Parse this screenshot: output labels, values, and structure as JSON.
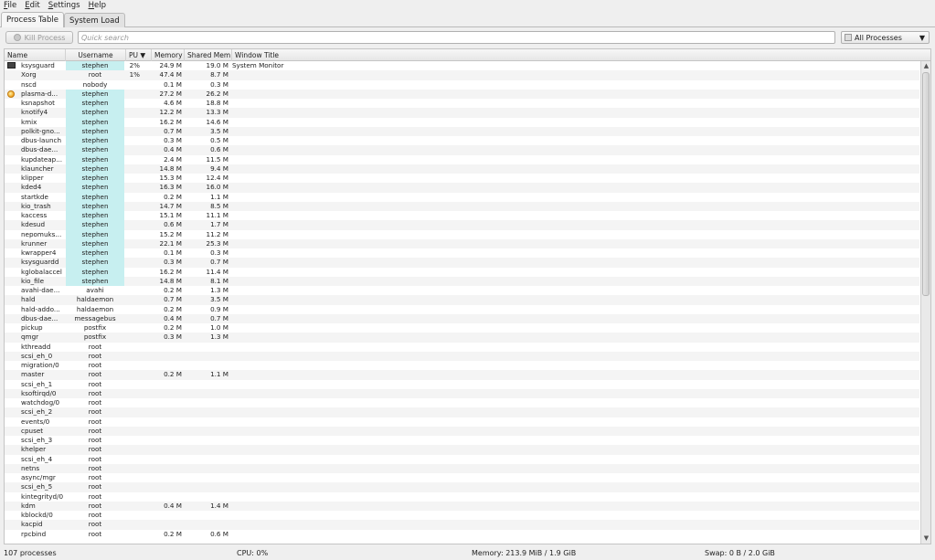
{
  "menu": [
    "File",
    "Edit",
    "Settings",
    "Help"
  ],
  "tabs": [
    "Process Table",
    "System Load"
  ],
  "toolbar": {
    "kill_label": "Kill Process",
    "search_placeholder": "Quick search",
    "filter_value": "All Processes"
  },
  "columns": {
    "name": "Name",
    "username": "Username",
    "cpu": "PU",
    "memory": "Memory",
    "shared": "Shared Mem",
    "window_title": "Window Title"
  },
  "rows": [
    {
      "icon": "monitor",
      "name": "ksysguard",
      "user": "stephen",
      "cpu": "2%",
      "mem": "24.9 M",
      "shared": "19.0 M",
      "title": "System Monitor",
      "hl": true
    },
    {
      "icon": "",
      "name": "Xorg",
      "user": "root",
      "cpu": "1%",
      "mem": "47.4 M",
      "shared": "8.7 M",
      "title": "",
      "hl": false
    },
    {
      "icon": "",
      "name": "nscd",
      "user": "nobody",
      "cpu": "",
      "mem": "0.1 M",
      "shared": "0.3 M",
      "title": "",
      "hl": false
    },
    {
      "icon": "plasma",
      "name": "plasma-d...",
      "user": "stephen",
      "cpu": "",
      "mem": "27.2 M",
      "shared": "26.2 M",
      "title": "",
      "hl": true
    },
    {
      "icon": "",
      "name": "ksnapshot",
      "user": "stephen",
      "cpu": "",
      "mem": "4.6 M",
      "shared": "18.8 M",
      "title": "",
      "hl": true
    },
    {
      "icon": "",
      "name": "knotify4",
      "user": "stephen",
      "cpu": "",
      "mem": "12.2 M",
      "shared": "13.3 M",
      "title": "",
      "hl": true
    },
    {
      "icon": "",
      "name": "kmix",
      "user": "stephen",
      "cpu": "",
      "mem": "16.2 M",
      "shared": "14.6 M",
      "title": "",
      "hl": true
    },
    {
      "icon": "",
      "name": "polkit-gno...",
      "user": "stephen",
      "cpu": "",
      "mem": "0.7 M",
      "shared": "3.5 M",
      "title": "",
      "hl": true
    },
    {
      "icon": "",
      "name": "dbus-launch",
      "user": "stephen",
      "cpu": "",
      "mem": "0.3 M",
      "shared": "0.5 M",
      "title": "",
      "hl": true
    },
    {
      "icon": "",
      "name": "dbus-dae...",
      "user": "stephen",
      "cpu": "",
      "mem": "0.4 M",
      "shared": "0.6 M",
      "title": "",
      "hl": true
    },
    {
      "icon": "",
      "name": "kupdateap...",
      "user": "stephen",
      "cpu": "",
      "mem": "2.4 M",
      "shared": "11.5 M",
      "title": "",
      "hl": true
    },
    {
      "icon": "",
      "name": "klauncher",
      "user": "stephen",
      "cpu": "",
      "mem": "14.8 M",
      "shared": "9.4 M",
      "title": "",
      "hl": true
    },
    {
      "icon": "",
      "name": "klipper",
      "user": "stephen",
      "cpu": "",
      "mem": "15.3 M",
      "shared": "12.4 M",
      "title": "",
      "hl": true
    },
    {
      "icon": "",
      "name": "kded4",
      "user": "stephen",
      "cpu": "",
      "mem": "16.3 M",
      "shared": "16.0 M",
      "title": "",
      "hl": true
    },
    {
      "icon": "",
      "name": "startkde",
      "user": "stephen",
      "cpu": "",
      "mem": "0.2 M",
      "shared": "1.1 M",
      "title": "",
      "hl": true
    },
    {
      "icon": "",
      "name": "kio_trash",
      "user": "stephen",
      "cpu": "",
      "mem": "14.7 M",
      "shared": "8.5 M",
      "title": "",
      "hl": true
    },
    {
      "icon": "",
      "name": "kaccess",
      "user": "stephen",
      "cpu": "",
      "mem": "15.1 M",
      "shared": "11.1 M",
      "title": "",
      "hl": true
    },
    {
      "icon": "",
      "name": "kdesud",
      "user": "stephen",
      "cpu": "",
      "mem": "0.6 M",
      "shared": "1.7 M",
      "title": "",
      "hl": true
    },
    {
      "icon": "",
      "name": "nepomuks...",
      "user": "stephen",
      "cpu": "",
      "mem": "15.2 M",
      "shared": "11.2 M",
      "title": "",
      "hl": true
    },
    {
      "icon": "",
      "name": "krunner",
      "user": "stephen",
      "cpu": "",
      "mem": "22.1 M",
      "shared": "25.3 M",
      "title": "",
      "hl": true
    },
    {
      "icon": "",
      "name": "kwrapper4",
      "user": "stephen",
      "cpu": "",
      "mem": "0.1 M",
      "shared": "0.3 M",
      "title": "",
      "hl": true
    },
    {
      "icon": "",
      "name": "ksysguardd",
      "user": "stephen",
      "cpu": "",
      "mem": "0.3 M",
      "shared": "0.7 M",
      "title": "",
      "hl": true
    },
    {
      "icon": "",
      "name": "kglobalaccel",
      "user": "stephen",
      "cpu": "",
      "mem": "16.2 M",
      "shared": "11.4 M",
      "title": "",
      "hl": true
    },
    {
      "icon": "",
      "name": "kio_file",
      "user": "stephen",
      "cpu": "",
      "mem": "14.8 M",
      "shared": "8.1 M",
      "title": "",
      "hl": true
    },
    {
      "icon": "",
      "name": "avahi-dae...",
      "user": "avahi",
      "cpu": "",
      "mem": "0.2 M",
      "shared": "1.3 M",
      "title": "",
      "hl": false
    },
    {
      "icon": "",
      "name": "hald",
      "user": "haldaemon",
      "cpu": "",
      "mem": "0.7 M",
      "shared": "3.5 M",
      "title": "",
      "hl": false
    },
    {
      "icon": "",
      "name": "hald-addo...",
      "user": "haldaemon",
      "cpu": "",
      "mem": "0.2 M",
      "shared": "0.9 M",
      "title": "",
      "hl": false
    },
    {
      "icon": "",
      "name": "dbus-dae...",
      "user": "messagebus",
      "cpu": "",
      "mem": "0.4 M",
      "shared": "0.7 M",
      "title": "",
      "hl": false
    },
    {
      "icon": "",
      "name": "pickup",
      "user": "postfix",
      "cpu": "",
      "mem": "0.2 M",
      "shared": "1.0 M",
      "title": "",
      "hl": false
    },
    {
      "icon": "",
      "name": "qmgr",
      "user": "postfix",
      "cpu": "",
      "mem": "0.3 M",
      "shared": "1.3 M",
      "title": "",
      "hl": false
    },
    {
      "icon": "",
      "name": "kthreadd",
      "user": "root",
      "cpu": "",
      "mem": "",
      "shared": "",
      "title": "",
      "hl": false
    },
    {
      "icon": "",
      "name": "scsi_eh_0",
      "user": "root",
      "cpu": "",
      "mem": "",
      "shared": "",
      "title": "",
      "hl": false
    },
    {
      "icon": "",
      "name": "migration/0",
      "user": "root",
      "cpu": "",
      "mem": "",
      "shared": "",
      "title": "",
      "hl": false
    },
    {
      "icon": "",
      "name": "master",
      "user": "root",
      "cpu": "",
      "mem": "0.2 M",
      "shared": "1.1 M",
      "title": "",
      "hl": false
    },
    {
      "icon": "",
      "name": "scsi_eh_1",
      "user": "root",
      "cpu": "",
      "mem": "",
      "shared": "",
      "title": "",
      "hl": false
    },
    {
      "icon": "",
      "name": "ksoftirqd/0",
      "user": "root",
      "cpu": "",
      "mem": "",
      "shared": "",
      "title": "",
      "hl": false
    },
    {
      "icon": "",
      "name": "watchdog/0",
      "user": "root",
      "cpu": "",
      "mem": "",
      "shared": "",
      "title": "",
      "hl": false
    },
    {
      "icon": "",
      "name": "scsi_eh_2",
      "user": "root",
      "cpu": "",
      "mem": "",
      "shared": "",
      "title": "",
      "hl": false
    },
    {
      "icon": "",
      "name": "events/0",
      "user": "root",
      "cpu": "",
      "mem": "",
      "shared": "",
      "title": "",
      "hl": false
    },
    {
      "icon": "",
      "name": "cpuset",
      "user": "root",
      "cpu": "",
      "mem": "",
      "shared": "",
      "title": "",
      "hl": false
    },
    {
      "icon": "",
      "name": "scsi_eh_3",
      "user": "root",
      "cpu": "",
      "mem": "",
      "shared": "",
      "title": "",
      "hl": false
    },
    {
      "icon": "",
      "name": "khelper",
      "user": "root",
      "cpu": "",
      "mem": "",
      "shared": "",
      "title": "",
      "hl": false
    },
    {
      "icon": "",
      "name": "scsi_eh_4",
      "user": "root",
      "cpu": "",
      "mem": "",
      "shared": "",
      "title": "",
      "hl": false
    },
    {
      "icon": "",
      "name": "netns",
      "user": "root",
      "cpu": "",
      "mem": "",
      "shared": "",
      "title": "",
      "hl": false
    },
    {
      "icon": "",
      "name": "async/mgr",
      "user": "root",
      "cpu": "",
      "mem": "",
      "shared": "",
      "title": "",
      "hl": false
    },
    {
      "icon": "",
      "name": "scsi_eh_5",
      "user": "root",
      "cpu": "",
      "mem": "",
      "shared": "",
      "title": "",
      "hl": false
    },
    {
      "icon": "",
      "name": "kintegrityd/0",
      "user": "root",
      "cpu": "",
      "mem": "",
      "shared": "",
      "title": "",
      "hl": false
    },
    {
      "icon": "",
      "name": "kdm",
      "user": "root",
      "cpu": "",
      "mem": "0.4 M",
      "shared": "1.4 M",
      "title": "",
      "hl": false
    },
    {
      "icon": "",
      "name": "kblockd/0",
      "user": "root",
      "cpu": "",
      "mem": "",
      "shared": "",
      "title": "",
      "hl": false
    },
    {
      "icon": "",
      "name": "kacpid",
      "user": "root",
      "cpu": "",
      "mem": "",
      "shared": "",
      "title": "",
      "hl": false
    },
    {
      "icon": "",
      "name": "rpcbind",
      "user": "root",
      "cpu": "",
      "mem": "0.2 M",
      "shared": "0.6 M",
      "title": "",
      "hl": false
    }
  ],
  "status": {
    "processes": "107 processes",
    "cpu": "CPU: 0%",
    "memory": "Memory: 213.9 MiB / 1.9 GiB",
    "swap": "Swap: 0 B / 2.0 GiB"
  }
}
